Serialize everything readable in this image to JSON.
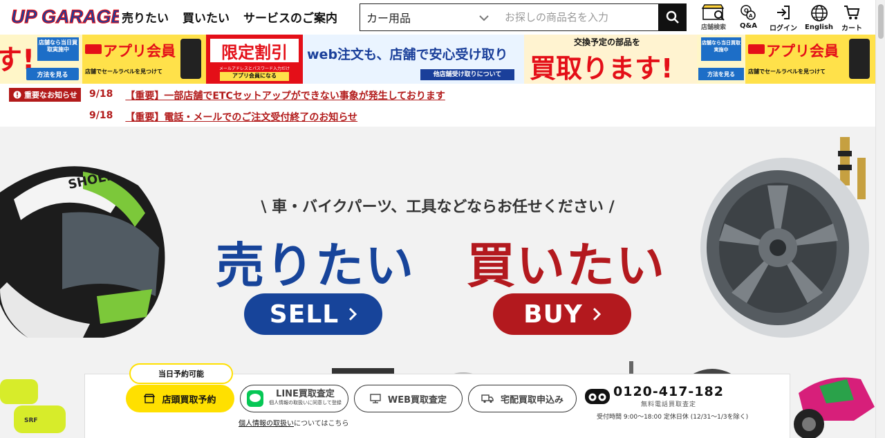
{
  "header": {
    "logo_text": "UP GARAGE",
    "nav": [
      "売りたい",
      "買いたい",
      "サービスのご案内"
    ],
    "search": {
      "category": "カー用品",
      "placeholder": "お探しの商品名を入力"
    },
    "utils": [
      {
        "icon": "store-search-icon",
        "label": "店舗検索"
      },
      {
        "icon": "qa-icon",
        "label": "Q&A"
      },
      {
        "icon": "login-icon",
        "label": "ログイン"
      },
      {
        "icon": "globe-icon",
        "label": "English"
      },
      {
        "icon": "cart-icon",
        "label": "カート"
      }
    ]
  },
  "banners": {
    "b1": {
      "big": "す!",
      "badge": "方法を見る",
      "corner": "店舗なら当日買取実施中"
    },
    "b2": {
      "title": "アプリ会員",
      "sub": "店舗でセールラベルを見つけて"
    },
    "b3": {
      "title": "限定割引",
      "sub": "メールアドレスとパスワード入力だけ",
      "foot": "アプリ会員になる"
    },
    "b4": {
      "title": "web注文も、店舗で安心受け取り",
      "foot": "他店舗受け取りについて"
    },
    "b5": {
      "top": "交換予定の部品を",
      "big": "買取ります!"
    },
    "b6": {
      "corner": "店舗なら当日買取実施中",
      "badge": "方法を見る"
    },
    "b7": {
      "title": "アプリ会員",
      "sub": "店舗でセールラベルを見つけて"
    }
  },
  "news": {
    "badge": "重要なお知らせ",
    "items": [
      {
        "date": "9/18",
        "title": "【重要】一部店舗でETCセットアップができない事象が発生しております"
      },
      {
        "date": "9/18",
        "title": "【重要】電話・メールでのご注文受付終了のお知らせ"
      }
    ]
  },
  "hero": {
    "tagline": "\\ 車・バイクパーツ、工具などならお任せください /",
    "sell_big": "売りたい",
    "buy_big": "買いたい",
    "sell_cta": "SELL",
    "buy_cta": "BUY"
  },
  "bottom": {
    "tip": "当日予約可能",
    "store_button": "店頭買取予約",
    "line_button": "LINE買取査定",
    "line_sub": "個人情報の取扱いに同意して登録",
    "web_button": "WEB買取査定",
    "delivery_button": "宅配買取申込み",
    "privacy_link": "個人情報の取扱い",
    "privacy_suffix": "についてはこちら",
    "phone": "0120-417-182",
    "phone_sub": "無料電話買取査定",
    "hours": "受付時間 9:00〜18:00 定休日休 (12/31〜1/3を除く)"
  },
  "colors": {
    "sell": "#17449a",
    "buy": "#b3191e",
    "accent_yellow": "#ffe000",
    "news": "#b21a1a"
  }
}
